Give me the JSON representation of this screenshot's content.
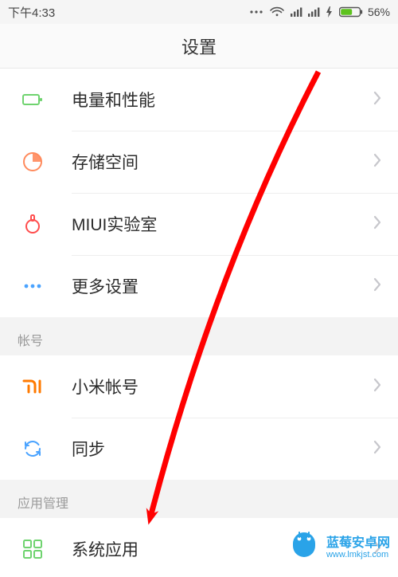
{
  "status": {
    "time": "下午4:33",
    "battery_pct": "56%"
  },
  "header": {
    "title": "设置"
  },
  "rows": {
    "battery": {
      "label": "电量和性能"
    },
    "storage": {
      "label": "存储空间"
    },
    "lab": {
      "label": "MIUI实验室"
    },
    "more": {
      "label": "更多设置"
    },
    "account_header": "帐号",
    "mi_account": {
      "label": "小米帐号"
    },
    "sync": {
      "label": "同步"
    },
    "app_mgmt_header": "应用管理",
    "system_apps": {
      "label": "系统应用"
    }
  },
  "watermark": {
    "title": "蓝莓安卓网",
    "url": "www.lmkjst.com"
  }
}
